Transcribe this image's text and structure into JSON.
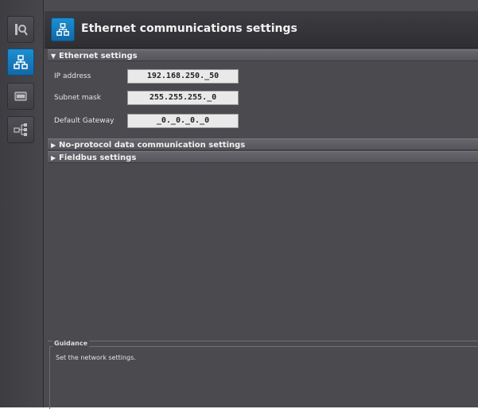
{
  "sidebar": {
    "items": [
      {
        "icon": "monitor-zoom-icon",
        "active": false
      },
      {
        "icon": "network-icon",
        "active": true
      },
      {
        "icon": "io-terminal-icon",
        "active": false
      },
      {
        "icon": "fieldbus-tree-icon",
        "active": false
      }
    ]
  },
  "header": {
    "icon": "network-icon",
    "title": "Ethernet communications settings"
  },
  "ethernet": {
    "header": "Ethernet settings",
    "expanded": true,
    "fields": [
      {
        "label": "IP address",
        "value": "192.168.250._50"
      },
      {
        "label": "Subnet mask",
        "value": "255.255.255._0"
      },
      {
        "label": "Default Gateway",
        "value": "_0._0._0._0"
      }
    ]
  },
  "noprotocol": {
    "header": "No-protocol data communication settings",
    "expanded": false
  },
  "fieldbus": {
    "header": "Fieldbus settings",
    "expanded": false
  },
  "guidance": {
    "title": "Guidance",
    "text": "Set the network settings."
  },
  "colors": {
    "accent": "#1a7fc2",
    "background": "#4a4a4f",
    "input_bg": "#e9e9e9"
  }
}
